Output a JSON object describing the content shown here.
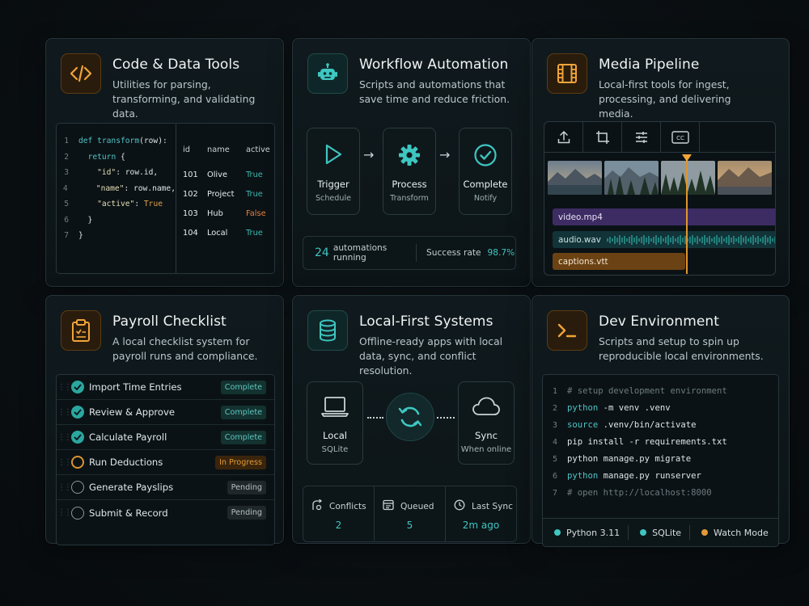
{
  "colors": {
    "accent_teal": "#3fc6c0",
    "accent_orange": "#e29a39",
    "accent_purple": "#3d2c63"
  },
  "code_tools": {
    "title": "Code & Data Tools",
    "description": "Utilities for parsing, transforming, and validating data.",
    "icon": "code-brackets-icon",
    "code_lines": [
      {
        "num": "1",
        "text": "def transform(row):"
      },
      {
        "num": "2",
        "text": "  return {"
      },
      {
        "num": "3",
        "text": "    \"id\": row.id,"
      },
      {
        "num": "4",
        "text": "    \"name\": row.name,"
      },
      {
        "num": "5",
        "text": "    \"active\": True"
      },
      {
        "num": "6",
        "text": "  }"
      },
      {
        "num": "7",
        "text": "}"
      }
    ],
    "table_headers": [
      "id",
      "name",
      "active"
    ],
    "table_rows": [
      [
        "101",
        "Olive",
        "True"
      ],
      [
        "102",
        "Project",
        "True"
      ],
      [
        "103",
        "Hub",
        "False"
      ],
      [
        "104",
        "Local",
        "True"
      ]
    ]
  },
  "workflow": {
    "title": "Workflow Automation",
    "description": "Scripts and automations that save time and reduce friction.",
    "icon": "robot-icon",
    "steps": [
      {
        "label": "Trigger",
        "sub": "Schedule",
        "icon": "play-icon"
      },
      {
        "label": "Process",
        "sub": "Transform",
        "icon": "gear-icon"
      },
      {
        "label": "Complete",
        "sub": "Notify",
        "icon": "check-circle-icon"
      }
    ],
    "running_count": "24",
    "running_label": "automations running",
    "success_label": "Success rate",
    "success_value": "98.7%"
  },
  "media": {
    "title": "Media Pipeline",
    "description": "Local-first tools for ingest, processing, and delivering media.",
    "icon": "film-icon",
    "tools": [
      "upload-icon",
      "crop-icon",
      "sliders-icon",
      "captions-icon"
    ],
    "tracks": {
      "video": "video.mp4",
      "audio": "audio.wav",
      "captions": "captions.vtt"
    }
  },
  "payroll": {
    "title": "Payroll Checklist",
    "description": "A local checklist system for payroll runs and compliance.",
    "icon": "clipboard-check-icon",
    "items": [
      {
        "label": "Import Time Entries",
        "status": "Complete"
      },
      {
        "label": "Review & Approve",
        "status": "Complete"
      },
      {
        "label": "Calculate Payroll",
        "status": "Complete"
      },
      {
        "label": "Run Deductions",
        "status": "In Progress"
      },
      {
        "label": "Generate Payslips",
        "status": "Pending"
      },
      {
        "label": "Submit & Record",
        "status": "Pending"
      }
    ]
  },
  "local_first": {
    "title": "Local-First Systems",
    "description": "Offline-ready apps with local data, sync, and conflict resolution.",
    "icon": "database-icon",
    "local": {
      "label": "Local",
      "sub": "SQLite"
    },
    "sync": {
      "label": "Sync",
      "sub": "When online"
    },
    "stats": [
      {
        "label": "Conflicts",
        "value": "2",
        "icon": "conflict-icon"
      },
      {
        "label": "Queued",
        "value": "5",
        "icon": "queue-icon"
      },
      {
        "label": "Last Sync",
        "value": "2m ago",
        "icon": "clock-icon"
      }
    ]
  },
  "dev_env": {
    "title": "Dev Environment",
    "description": "Scripts and setup to spin up reproducible local environments.",
    "icon": "terminal-icon",
    "lines": [
      {
        "num": "1",
        "cmd": "",
        "rest": "# setup development environment",
        "comment": true
      },
      {
        "num": "2",
        "cmd": "python",
        "rest": " -m venv .venv",
        "comment": false
      },
      {
        "num": "3",
        "cmd": "source",
        "rest": " .venv/bin/activate",
        "comment": false
      },
      {
        "num": "4",
        "cmd": "",
        "rest": "pip install -r requirements.txt",
        "comment": false
      },
      {
        "num": "5",
        "cmd": "",
        "rest": "python manage.py migrate",
        "comment": false
      },
      {
        "num": "6",
        "cmd": "python",
        "rest": " manage.py runserver",
        "comment": false
      },
      {
        "num": "7",
        "cmd": "",
        "rest": "# open http://localhost:8000",
        "comment": true
      }
    ],
    "env_items": [
      {
        "label": "Python 3.11",
        "color": "#3fc6c0"
      },
      {
        "label": "SQLite",
        "color": "#3fc6c0"
      },
      {
        "label": "Watch Mode",
        "color": "#e29a39"
      }
    ]
  }
}
